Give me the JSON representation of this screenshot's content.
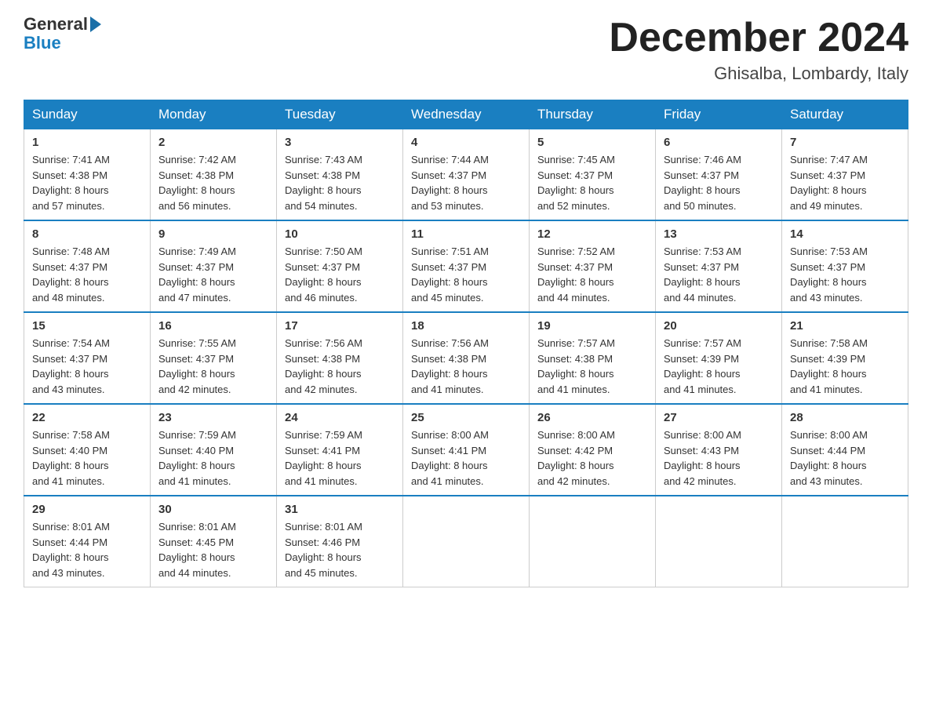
{
  "header": {
    "logo_general": "General",
    "logo_blue": "Blue",
    "month_title": "December 2024",
    "location": "Ghisalba, Lombardy, Italy"
  },
  "weekdays": [
    "Sunday",
    "Monday",
    "Tuesday",
    "Wednesday",
    "Thursday",
    "Friday",
    "Saturday"
  ],
  "weeks": [
    [
      {
        "day": "1",
        "sunrise": "7:41 AM",
        "sunset": "4:38 PM",
        "daylight": "8 hours and 57 minutes."
      },
      {
        "day": "2",
        "sunrise": "7:42 AM",
        "sunset": "4:38 PM",
        "daylight": "8 hours and 56 minutes."
      },
      {
        "day": "3",
        "sunrise": "7:43 AM",
        "sunset": "4:38 PM",
        "daylight": "8 hours and 54 minutes."
      },
      {
        "day": "4",
        "sunrise": "7:44 AM",
        "sunset": "4:37 PM",
        "daylight": "8 hours and 53 minutes."
      },
      {
        "day": "5",
        "sunrise": "7:45 AM",
        "sunset": "4:37 PM",
        "daylight": "8 hours and 52 minutes."
      },
      {
        "day": "6",
        "sunrise": "7:46 AM",
        "sunset": "4:37 PM",
        "daylight": "8 hours and 50 minutes."
      },
      {
        "day": "7",
        "sunrise": "7:47 AM",
        "sunset": "4:37 PM",
        "daylight": "8 hours and 49 minutes."
      }
    ],
    [
      {
        "day": "8",
        "sunrise": "7:48 AM",
        "sunset": "4:37 PM",
        "daylight": "8 hours and 48 minutes."
      },
      {
        "day": "9",
        "sunrise": "7:49 AM",
        "sunset": "4:37 PM",
        "daylight": "8 hours and 47 minutes."
      },
      {
        "day": "10",
        "sunrise": "7:50 AM",
        "sunset": "4:37 PM",
        "daylight": "8 hours and 46 minutes."
      },
      {
        "day": "11",
        "sunrise": "7:51 AM",
        "sunset": "4:37 PM",
        "daylight": "8 hours and 45 minutes."
      },
      {
        "day": "12",
        "sunrise": "7:52 AM",
        "sunset": "4:37 PM",
        "daylight": "8 hours and 44 minutes."
      },
      {
        "day": "13",
        "sunrise": "7:53 AM",
        "sunset": "4:37 PM",
        "daylight": "8 hours and 44 minutes."
      },
      {
        "day": "14",
        "sunrise": "7:53 AM",
        "sunset": "4:37 PM",
        "daylight": "8 hours and 43 minutes."
      }
    ],
    [
      {
        "day": "15",
        "sunrise": "7:54 AM",
        "sunset": "4:37 PM",
        "daylight": "8 hours and 43 minutes."
      },
      {
        "day": "16",
        "sunrise": "7:55 AM",
        "sunset": "4:37 PM",
        "daylight": "8 hours and 42 minutes."
      },
      {
        "day": "17",
        "sunrise": "7:56 AM",
        "sunset": "4:38 PM",
        "daylight": "8 hours and 42 minutes."
      },
      {
        "day": "18",
        "sunrise": "7:56 AM",
        "sunset": "4:38 PM",
        "daylight": "8 hours and 41 minutes."
      },
      {
        "day": "19",
        "sunrise": "7:57 AM",
        "sunset": "4:38 PM",
        "daylight": "8 hours and 41 minutes."
      },
      {
        "day": "20",
        "sunrise": "7:57 AM",
        "sunset": "4:39 PM",
        "daylight": "8 hours and 41 minutes."
      },
      {
        "day": "21",
        "sunrise": "7:58 AM",
        "sunset": "4:39 PM",
        "daylight": "8 hours and 41 minutes."
      }
    ],
    [
      {
        "day": "22",
        "sunrise": "7:58 AM",
        "sunset": "4:40 PM",
        "daylight": "8 hours and 41 minutes."
      },
      {
        "day": "23",
        "sunrise": "7:59 AM",
        "sunset": "4:40 PM",
        "daylight": "8 hours and 41 minutes."
      },
      {
        "day": "24",
        "sunrise": "7:59 AM",
        "sunset": "4:41 PM",
        "daylight": "8 hours and 41 minutes."
      },
      {
        "day": "25",
        "sunrise": "8:00 AM",
        "sunset": "4:41 PM",
        "daylight": "8 hours and 41 minutes."
      },
      {
        "day": "26",
        "sunrise": "8:00 AM",
        "sunset": "4:42 PM",
        "daylight": "8 hours and 42 minutes."
      },
      {
        "day": "27",
        "sunrise": "8:00 AM",
        "sunset": "4:43 PM",
        "daylight": "8 hours and 42 minutes."
      },
      {
        "day": "28",
        "sunrise": "8:00 AM",
        "sunset": "4:44 PM",
        "daylight": "8 hours and 43 minutes."
      }
    ],
    [
      {
        "day": "29",
        "sunrise": "8:01 AM",
        "sunset": "4:44 PM",
        "daylight": "8 hours and 43 minutes."
      },
      {
        "day": "30",
        "sunrise": "8:01 AM",
        "sunset": "4:45 PM",
        "daylight": "8 hours and 44 minutes."
      },
      {
        "day": "31",
        "sunrise": "8:01 AM",
        "sunset": "4:46 PM",
        "daylight": "8 hours and 45 minutes."
      },
      null,
      null,
      null,
      null
    ]
  ],
  "labels": {
    "sunrise": "Sunrise:",
    "sunset": "Sunset:",
    "daylight": "Daylight:"
  }
}
